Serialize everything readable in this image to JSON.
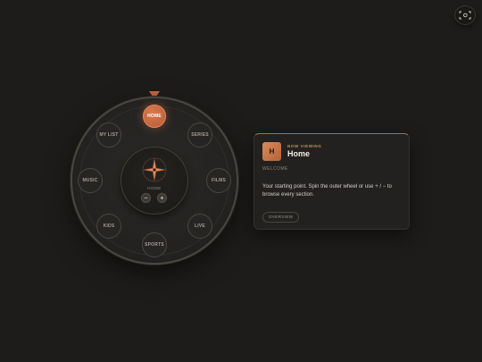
{
  "corner": {
    "icon": "expand-icon"
  },
  "wheel": {
    "pointer_icon": "pointer-triangle-icon",
    "items": [
      {
        "label": "HOME",
        "active": true
      },
      {
        "label": "SERIES",
        "active": false
      },
      {
        "label": "FILMS",
        "active": false
      },
      {
        "label": "LIVE",
        "active": false
      },
      {
        "label": "SPORTS",
        "active": false
      },
      {
        "label": "KIDS",
        "active": false
      },
      {
        "label": "MUSIC",
        "active": false
      },
      {
        "label": "MY LIST",
        "active": false
      }
    ]
  },
  "hub": {
    "icon": "compass-icon",
    "label": "HOME",
    "minus_label": "−",
    "plus_label": "+"
  },
  "panel": {
    "badge": "H",
    "eyebrow": "NOW VIEWING",
    "title": "Home",
    "section": "WELCOME",
    "description": "Your starting point. Spin the outer wheel or use + / − to browse every section.",
    "button_label": "OVERVIEW"
  },
  "colors": {
    "accent": "#c8683f",
    "background": "#1d1c1a"
  }
}
